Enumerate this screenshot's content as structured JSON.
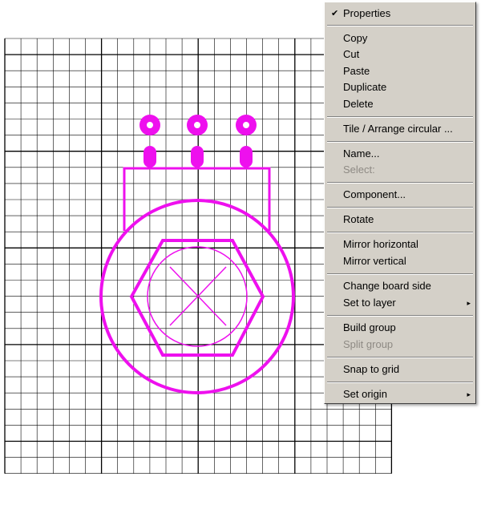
{
  "colors": {
    "background": "#ffffff",
    "grid_minor": "#000000",
    "grid_major": "#000000",
    "component": "#ee10ee",
    "menu_bg": "#d4d0c8",
    "menu_disabled": "#8e8a84"
  },
  "context_menu": {
    "properties": "Properties",
    "copy": "Copy",
    "cut": "Cut",
    "paste": "Paste",
    "duplicate": "Duplicate",
    "delete": "Delete",
    "tile_arrange": "Tile / Arrange circular ...",
    "name": "Name...",
    "select": "Select:",
    "component": "Component...",
    "rotate": "Rotate",
    "mirror_horizontal": "Mirror horizontal",
    "mirror_vertical": "Mirror vertical",
    "change_board_side": "Change board side",
    "set_to_layer": "Set to layer",
    "build_group": "Build group",
    "split_group": "Split group",
    "snap_to_grid": "Snap to grid",
    "set_origin": "Set origin",
    "checkmark_icon": "✔",
    "submenu_arrow_icon": "▸"
  }
}
